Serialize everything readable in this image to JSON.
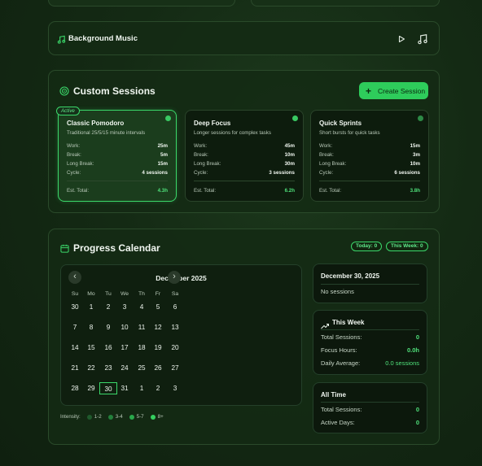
{
  "music": {
    "title": "Background Music",
    "icon": "music-note-icon"
  },
  "sessions": {
    "title": "Custom Sessions",
    "create_label": "Create Session",
    "active_badge": "Active",
    "cards": [
      {
        "name": "Classic Pomodoro",
        "desc": "Traditional 25/5/15 minute intervals",
        "work": "25m",
        "break": "5m",
        "long_break": "15m",
        "cycle": "4 sessions",
        "total": "4.3h"
      },
      {
        "name": "Deep Focus",
        "desc": "Longer sessions for complex tasks",
        "work": "45m",
        "break": "10m",
        "long_break": "30m",
        "cycle": "3 sessions",
        "total": "6.2h"
      },
      {
        "name": "Quick Sprints",
        "desc": "Short bursts for quick tasks",
        "work": "15m",
        "break": "3m",
        "long_break": "10m",
        "cycle": "6 sessions",
        "total": "3.8h"
      }
    ],
    "labels": {
      "work": "Work:",
      "break": "Break:",
      "long_break": "Long Break:",
      "cycle": "Cycle:",
      "total": "Est. Total:"
    }
  },
  "progress": {
    "title": "Progress Calendar",
    "today_pill": "Today: 0",
    "week_pill": "This Week: 0",
    "month": "December 2025",
    "prev": "‹",
    "next": "›",
    "dows": [
      "Su",
      "Mo",
      "Tu",
      "We",
      "Th",
      "Fr",
      "Sa"
    ],
    "weeks": [
      [
        "30",
        "1",
        "2",
        "3",
        "4",
        "5",
        "6"
      ],
      [
        "7",
        "8",
        "9",
        "10",
        "11",
        "12",
        "13"
      ],
      [
        "14",
        "15",
        "16",
        "17",
        "18",
        "19",
        "20"
      ],
      [
        "21",
        "22",
        "23",
        "24",
        "25",
        "26",
        "27"
      ],
      [
        "28",
        "29",
        "30",
        "31",
        "1",
        "2",
        "3"
      ]
    ],
    "intensity": {
      "label": "Intensity:",
      "levels": [
        "1-2",
        "3-4",
        "5-7",
        "8+"
      ]
    },
    "selected": {
      "date": "December 30, 2025",
      "text": "No sessions"
    },
    "week": {
      "title": "This Week",
      "total_label": "Total Sessions:",
      "total": "0",
      "hours_label": "Focus Hours:",
      "hours": "0.0h",
      "avg_label": "Daily Average:",
      "avg": "0.0 sessions"
    },
    "alltime": {
      "title": "All Time",
      "total_label": "Total Sessions:",
      "total": "0",
      "days_label": "Active Days:",
      "days": "0"
    }
  },
  "colors": {
    "accent": "#2ecc5b",
    "bg": "#142a14"
  }
}
